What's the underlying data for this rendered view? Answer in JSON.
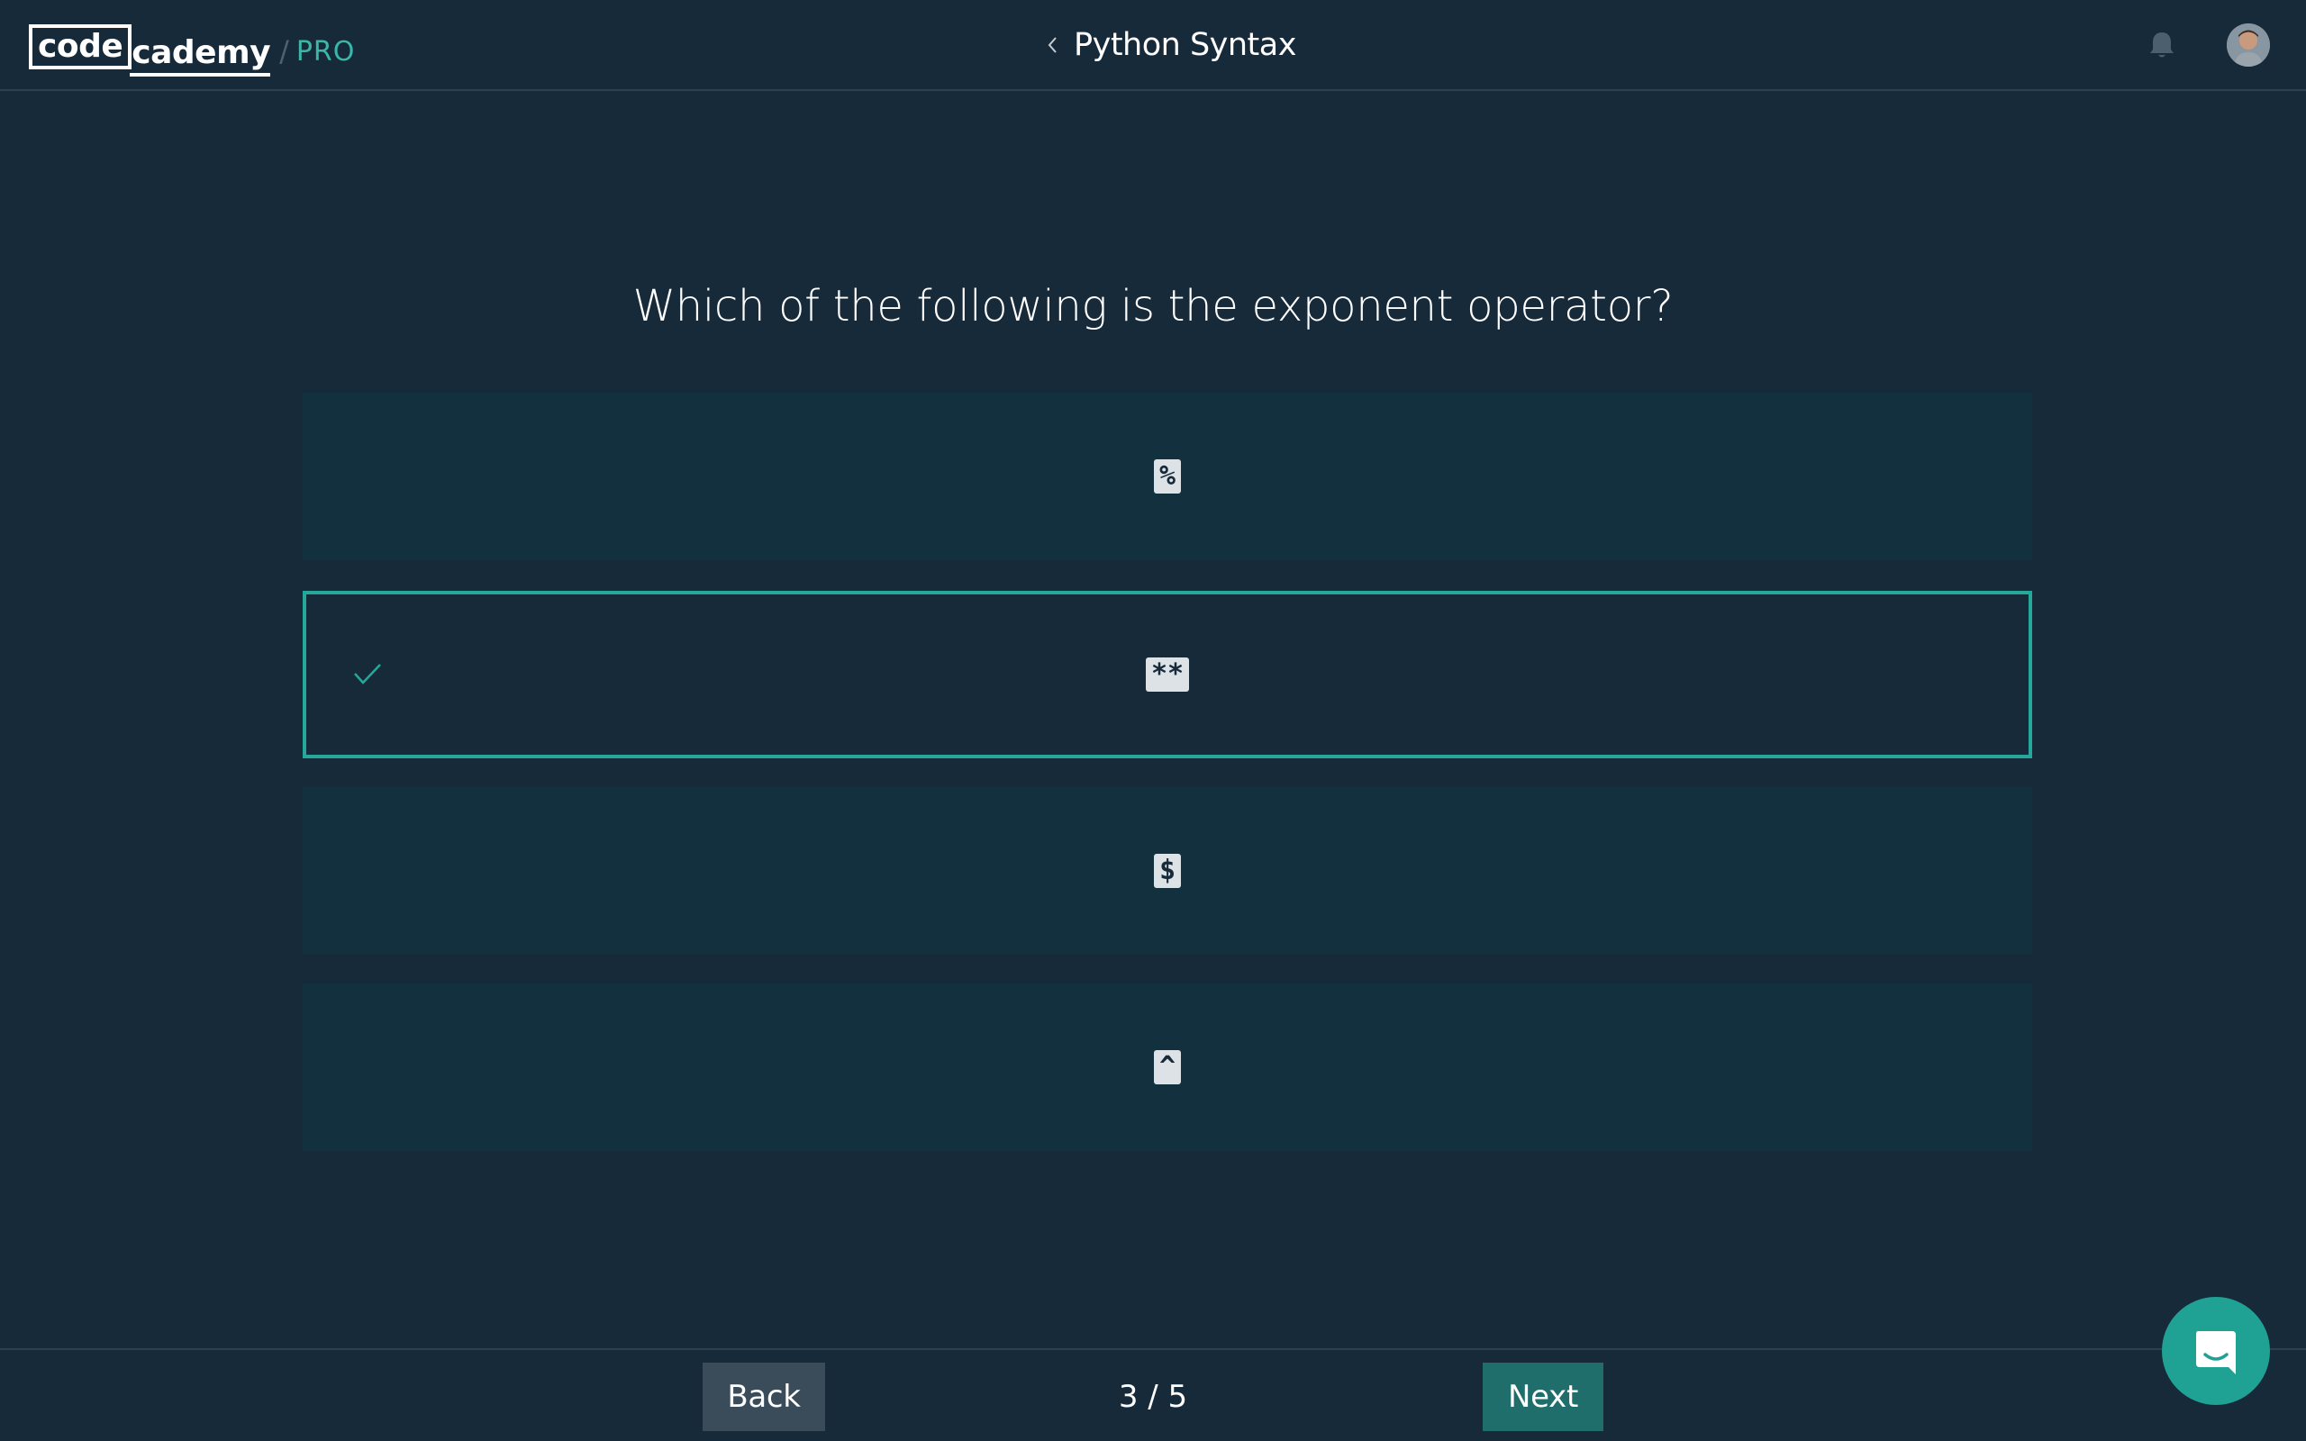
{
  "header": {
    "logo_left": "code",
    "logo_right": "cademy",
    "logo_separator": "/",
    "logo_tier": "PRO",
    "course_title": "Python Syntax"
  },
  "question": {
    "text": "Which of the following is the exponent operator?"
  },
  "options": [
    {
      "code": "%",
      "selected": false
    },
    {
      "code": "**",
      "selected": true
    },
    {
      "code": "$",
      "selected": false
    },
    {
      "code": "^",
      "selected": false
    }
  ],
  "footer": {
    "back_label": "Back",
    "next_label": "Next",
    "progress": "3 / 5"
  },
  "colors": {
    "background": "#172a3a",
    "option_background": "#13303f",
    "accent": "#25a89a",
    "next_button": "#1f6e6b",
    "back_button": "#3a4c5a",
    "chat_button": "#1fa193"
  },
  "icons": {
    "back_chevron": "chevron-left-icon",
    "notifications": "bell-icon",
    "selected_marker": "check-icon",
    "chat": "chat-icon"
  }
}
